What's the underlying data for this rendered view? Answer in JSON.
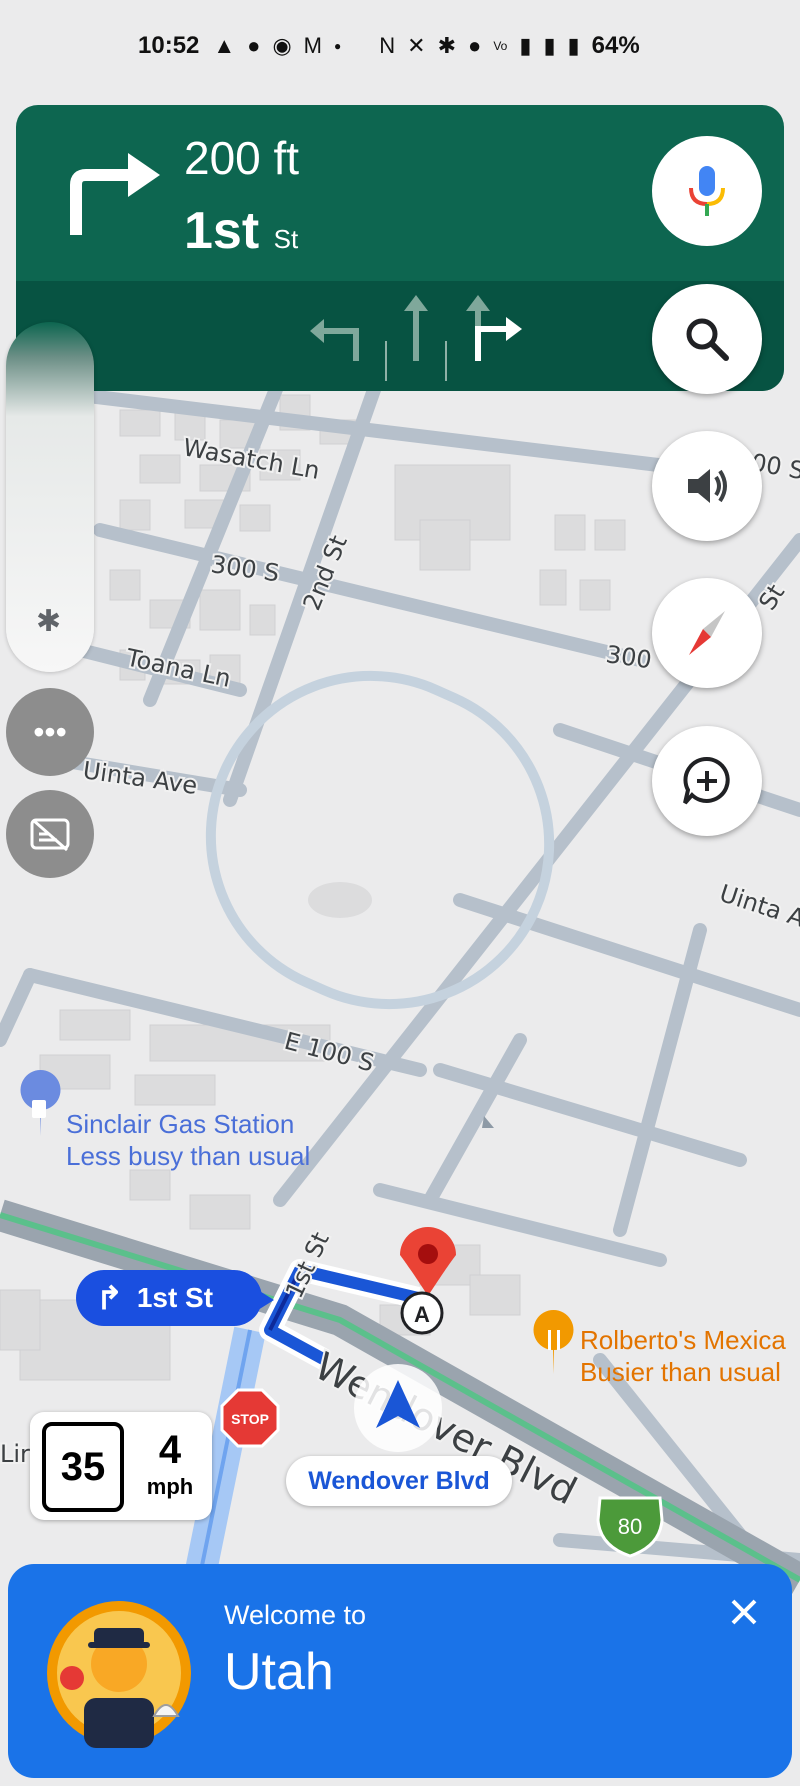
{
  "status_bar": {
    "time": "10:52",
    "battery": "64%",
    "icons": [
      "navigation-icon",
      "chat-icon",
      "wechat-icon",
      "gmail-icon",
      "dot-icon",
      "nfc-icon",
      "mute-icon",
      "bluetooth-icon",
      "location-icon",
      "volte-icon",
      "5g-signal-icon",
      "roaming-signal-icon",
      "battery-icon"
    ]
  },
  "navigation": {
    "distance": "200 ft",
    "street_main": "1st",
    "street_suffix": "St",
    "accent_color": "#0d6650"
  },
  "controls": {
    "voice": "mic-icon",
    "search": "search-icon",
    "sound": "volume-icon",
    "compass": "compass-icon",
    "report": "add-comment-icon"
  },
  "map": {
    "streets": [
      "Wasatch Ln",
      "300 S",
      "2nd St",
      "Toana Ln",
      "Uinta Ave",
      "300",
      "00 S",
      "St",
      "Uinta A",
      "E 100 S",
      "1st St",
      "Wendover Blvd",
      "Lir"
    ],
    "route_label": "1st St",
    "pois": [
      {
        "name": "Sinclair Gas Station",
        "busy": "Less busy than usual",
        "color": "#4a6fd8"
      },
      {
        "name": "Rolberto's Mexica",
        "busy": "Busier than usual",
        "color": "#e37400"
      }
    ],
    "destination_marker": "A",
    "stop_sign": "STOP",
    "highway_shield": "80"
  },
  "speed": {
    "limit": "35",
    "current": "4",
    "unit": "mph"
  },
  "current_road": "Wendover Blvd",
  "welcome": {
    "title": "Welcome to",
    "place": "Utah"
  }
}
